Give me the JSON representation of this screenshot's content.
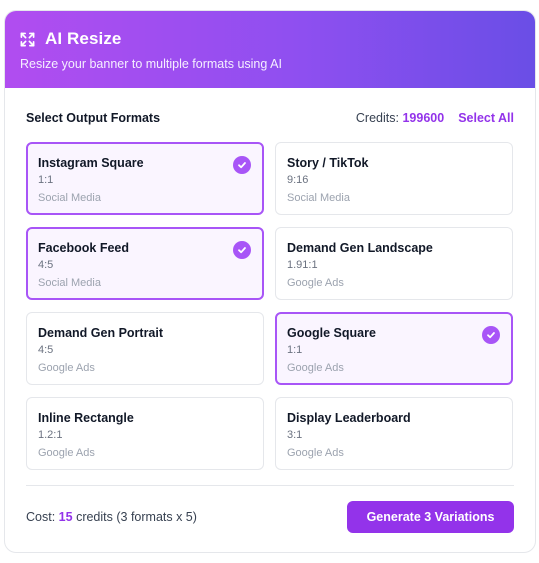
{
  "header": {
    "title": "AI Resize",
    "subtitle": "Resize your banner to multiple formats using AI",
    "icon": "expand-icon"
  },
  "toolbar": {
    "section_label": "Select Output Formats",
    "credits_label": "Credits:",
    "credits_value": "199600",
    "select_all_label": "Select All"
  },
  "formats": [
    {
      "name": "Instagram Square",
      "ratio": "1:1",
      "category": "Social Media",
      "selected": true
    },
    {
      "name": "Story / TikTok",
      "ratio": "9:16",
      "category": "Social Media",
      "selected": false
    },
    {
      "name": "Facebook Feed",
      "ratio": "4:5",
      "category": "Social Media",
      "selected": true
    },
    {
      "name": "Demand Gen Landscape",
      "ratio": "1.91:1",
      "category": "Google Ads",
      "selected": false
    },
    {
      "name": "Demand Gen Portrait",
      "ratio": "4:5",
      "category": "Google Ads",
      "selected": false
    },
    {
      "name": "Google Square",
      "ratio": "1:1",
      "category": "Google Ads",
      "selected": true
    },
    {
      "name": "Inline Rectangle",
      "ratio": "1.2:1",
      "category": "Google Ads",
      "selected": false
    },
    {
      "name": "Display Leaderboard",
      "ratio": "3:1",
      "category": "Google Ads",
      "selected": false
    }
  ],
  "footer": {
    "cost_label": "Cost:",
    "cost_value": "15",
    "cost_suffix": "credits (3 formats x 5)",
    "generate_label": "Generate 3 Variations"
  },
  "colors": {
    "accent": "#9333ea",
    "selected_border": "#a855f7",
    "selected_bg": "#faf5ff",
    "header_gradient_start": "#b14df0",
    "header_gradient_end": "#6a4ee6"
  }
}
